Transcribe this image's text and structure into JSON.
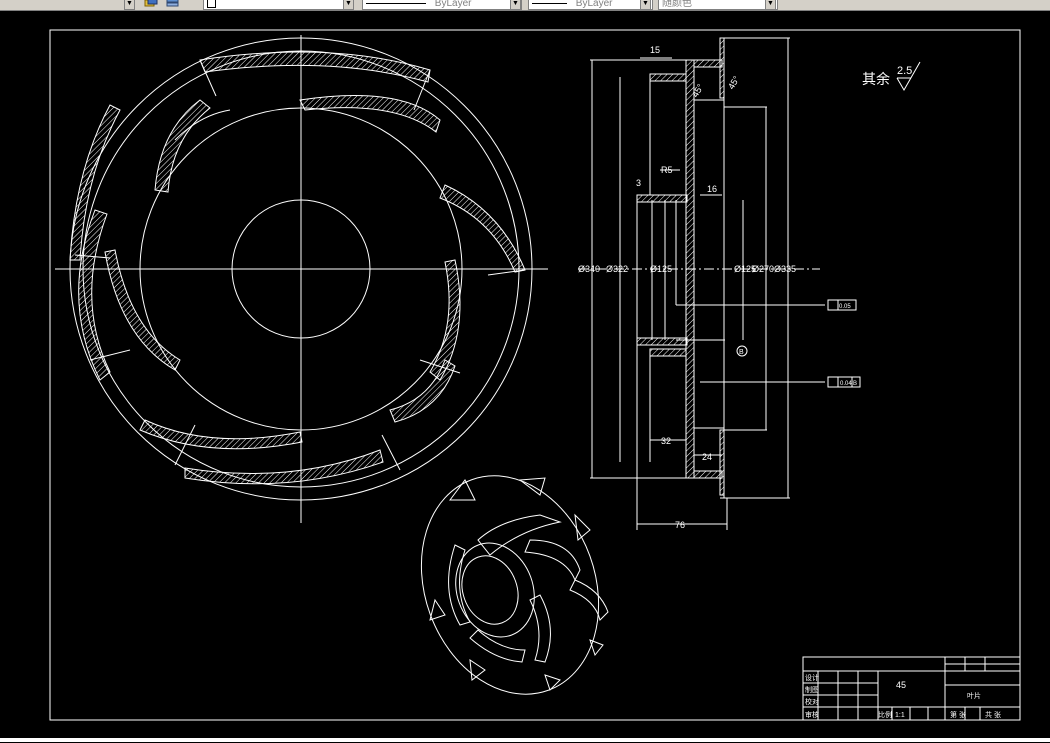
{
  "toolbar": {
    "layer_name": "",
    "linetype_label": "ByLayer",
    "lineweight_label": "ByLayer",
    "color_label": "随颜色"
  },
  "drawing": {
    "surface_note": "其余",
    "surface_roughness": "2.5",
    "dims": {
      "d340": "Ø340",
      "d322": "Ø322",
      "d125a": "Ø125",
      "d125b": "Ø125",
      "d270": "Ø270",
      "d335": "Ø335",
      "w15": "15",
      "w16": "16",
      "w32": "32",
      "w24": "24",
      "w76": "76",
      "r5": "R5",
      "c3": "3",
      "a45a": "45°",
      "a45b": "45°"
    },
    "tolerance_a": "0.05",
    "tolerance_b": "0.04",
    "datum": "B"
  },
  "title_block": {
    "material": "45",
    "part_name": "叶片",
    "row_labels": [
      "设计",
      "制图",
      "校对",
      "审核"
    ],
    "scale_label": "比例",
    "scale_value": "1:1",
    "sheet_label": "共 张",
    "page_label": "第 张"
  },
  "colors": {
    "line": "#ffffff",
    "background": "#000000",
    "toolbar": "#d4d0c8"
  }
}
